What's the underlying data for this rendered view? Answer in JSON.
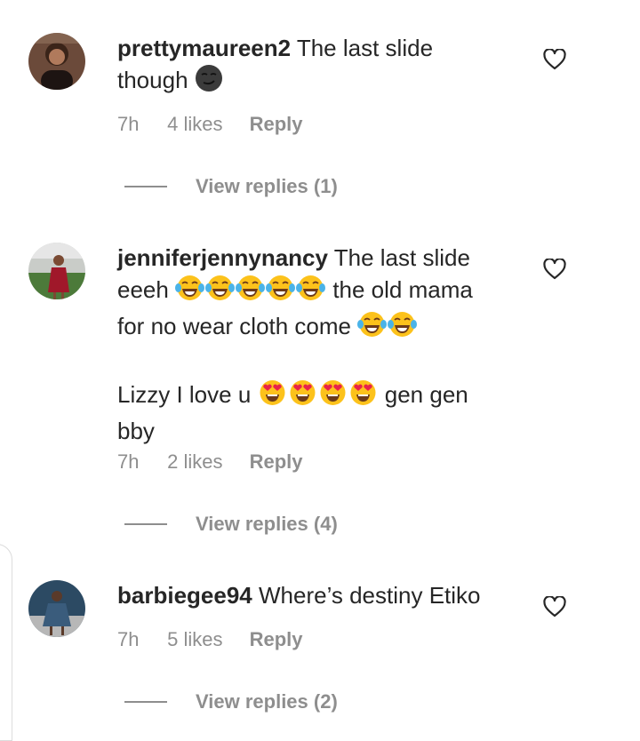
{
  "comments": [
    {
      "username": "prettymaureen2",
      "text_before": "The last slide though",
      "time": "7h",
      "likes": "4 likes",
      "reply": "Reply",
      "view_replies": "View replies (1)"
    },
    {
      "username": "jenniferjennynancy",
      "line1": "The last slide",
      "line2_a": "eeeh",
      "line2_b": "the old mama",
      "line3": "for no wear cloth come",
      "line4_a": "Lizzy I love u",
      "line4_b": "gen gen",
      "line5": "bby",
      "time": "7h",
      "likes": "2 likes",
      "reply": "Reply",
      "view_replies": "View replies (4)"
    },
    {
      "username": "barbiegee94",
      "text": "Where’s destiny Etiko",
      "time": "7h",
      "likes": "5 likes",
      "reply": "Reply",
      "view_replies": "View replies (2)"
    }
  ],
  "icons": {
    "like": "heart-outline-icon",
    "smirk_emoji": "smirking-face-emoji",
    "laugh_emoji": "tears-of-joy-emoji",
    "heart_eyes_emoji": "heart-eyes-emoji"
  },
  "colors": {
    "text": "#262626",
    "muted": "#8e8e8e"
  }
}
